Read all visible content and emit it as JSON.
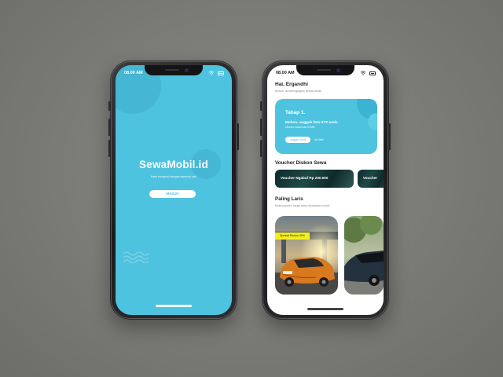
{
  "splash": {
    "time": "08.00 AM",
    "brand": "SewaMobil.id",
    "tagline": "Kami melayani dengan sepenuh hati",
    "login_button": "MASUK"
  },
  "home": {
    "time": "08.00 AM",
    "greeting": "Hai, Ergandhi",
    "greeting_sub": "Mohon, isi kelengkapan berkas anda",
    "step_card": {
      "title": "Tahap 1.",
      "text": "Mohon, unggah foto KTP anda",
      "sub": "ukuran maksimal 2GMB",
      "upload_button": "Unggah Disini",
      "later_link": "Isi Nanti"
    },
    "voucher_section": {
      "title": "Voucher Diskon Sewa",
      "items": [
        {
          "label": "Voucher Ngabuf Rp 200.000"
        },
        {
          "label": "Voucher"
        }
      ]
    },
    "popular_section": {
      "title": "Paling Laris",
      "sub": "Mobil populer, harga sewa di pastikan murah",
      "cars": [
        {
          "tag": "Spesial Diskon 30%"
        },
        {
          "tag": ""
        }
      ]
    }
  },
  "colors": {
    "accent": "#4ec3df",
    "promo": "#f4ee1c",
    "voucher_bg": "#1d4a46"
  }
}
